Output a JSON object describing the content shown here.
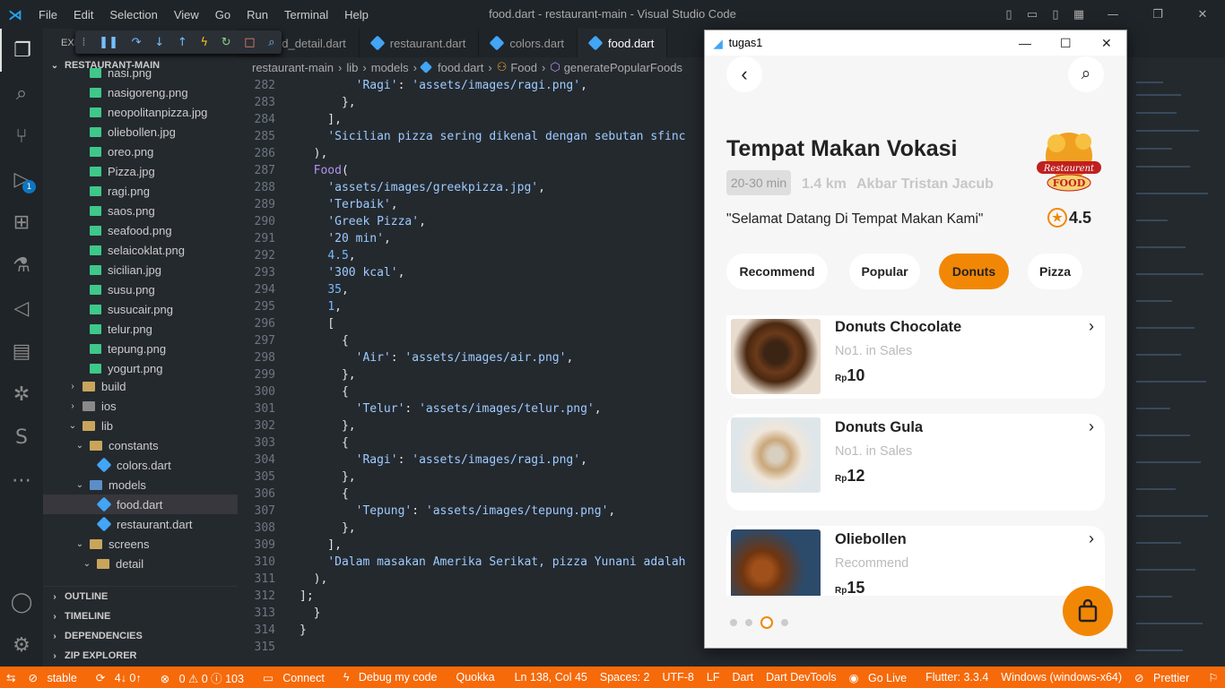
{
  "titlebar": {
    "menu": [
      "File",
      "Edit",
      "Selection",
      "View",
      "Go",
      "Run",
      "Terminal",
      "Help"
    ],
    "title": "food.dart - restaurant-main - Visual Studio Code"
  },
  "sidebar": {
    "header": "EXI",
    "root": "RESTAURANT-MAIN",
    "files": [
      "nasi.png",
      "nasigoreng.png",
      "neopolitanpizza.jpg",
      "oliebollen.jpg",
      "oreo.png",
      "Pizza.jpg",
      "ragi.png",
      "saos.png",
      "seafood.png",
      "selaicoklat.png",
      "sicilian.jpg",
      "susu.png",
      "susucair.png",
      "telur.png",
      "tepung.png",
      "yogurt.png"
    ],
    "folders": {
      "build": "build",
      "ios": "ios",
      "lib": "lib",
      "constants": "constants",
      "colors": "colors.dart",
      "models": "models",
      "food": "food.dart",
      "restaurant": "restaurant.dart",
      "screens": "screens",
      "detail": "detail"
    },
    "sections": [
      "OUTLINE",
      "TIMELINE",
      "DEPENDENCIES",
      "ZIP EXPLORER"
    ]
  },
  "tabs": [
    "od_detail.dart",
    "restaurant.dart",
    "colors.dart",
    "food.dart"
  ],
  "breadcrumb": [
    "restaurant-main",
    "lib",
    "models",
    "food.dart",
    "Food",
    "generatePopularFoods"
  ],
  "code": [
    {
      "n": "282",
      "t": "        'Ragi': 'assets/images/ragi.png',"
    },
    {
      "n": "283",
      "t": "      },"
    },
    {
      "n": "284",
      "t": "    ],"
    },
    {
      "n": "285",
      "t": "    'Sicilian pizza sering dikenal dengan sebutan sfinc"
    },
    {
      "n": "286",
      "t": "  ),"
    },
    {
      "n": "287",
      "t": "  Food("
    },
    {
      "n": "288",
      "t": "    'assets/images/greekpizza.jpg',"
    },
    {
      "n": "289",
      "t": "    'Terbaik',"
    },
    {
      "n": "290",
      "t": "    'Greek Pizza',"
    },
    {
      "n": "291",
      "t": "    '20 min',"
    },
    {
      "n": "292",
      "t": "    4.5,"
    },
    {
      "n": "293",
      "t": "    '300 kcal',"
    },
    {
      "n": "294",
      "t": "    35,"
    },
    {
      "n": "295",
      "t": "    1,"
    },
    {
      "n": "296",
      "t": "    ["
    },
    {
      "n": "297",
      "t": "      {"
    },
    {
      "n": "298",
      "t": "        'Air': 'assets/images/air.png',"
    },
    {
      "n": "299",
      "t": "      },"
    },
    {
      "n": "300",
      "t": "      {"
    },
    {
      "n": "301",
      "t": "        'Telur': 'assets/images/telur.png',"
    },
    {
      "n": "302",
      "t": "      },"
    },
    {
      "n": "303",
      "t": "      {"
    },
    {
      "n": "304",
      "t": "        'Ragi': 'assets/images/ragi.png',"
    },
    {
      "n": "305",
      "t": "      },"
    },
    {
      "n": "306",
      "t": "      {"
    },
    {
      "n": "307",
      "t": "        'Tepung': 'assets/images/tepung.png',"
    },
    {
      "n": "308",
      "t": "      },"
    },
    {
      "n": "309",
      "t": "    ],"
    },
    {
      "n": "310",
      "t": "    'Dalam masakan Amerika Serikat, pizza Yunani adalah"
    },
    {
      "n": "311",
      "t": "  ),"
    },
    {
      "n": "312",
      "t": "];"
    },
    {
      "n": "313",
      "t": "  }"
    },
    {
      "n": "314",
      "t": "}"
    },
    {
      "n": "315",
      "t": ""
    }
  ],
  "status": [
    "stable",
    "4↓ 0↑",
    "0 ⚠ 0 ⓘ 103",
    "Connect",
    "Debug my code",
    "Quokka",
    "Ln 138, Col 45",
    "Spaces: 2",
    "UTF-8",
    "LF",
    "Dart",
    "Dart DevTools",
    "Go Live",
    "Flutter: 3.3.4",
    "Windows (windows-x64)",
    "Prettier"
  ],
  "emulator": {
    "title": "tugas1",
    "restaurant": "Tempat Makan Vokasi",
    "time": "20-30 min",
    "distance": "1.4 km",
    "author": "Akbar Tristan Jacub",
    "welcome": "\"Selamat Datang Di Tempat Makan Kami\"",
    "rating": "4.5",
    "logo_text": "Restaurent FOOD",
    "categories": [
      "Recommend",
      "Popular",
      "Donuts",
      "Pizza"
    ],
    "items": [
      {
        "name": "Donuts Chocolate",
        "highlight": "No1. in Sales",
        "currency": "Rp",
        "price": "10"
      },
      {
        "name": "Donuts Gula",
        "highlight": "No1. in Sales",
        "currency": "Rp",
        "price": "12"
      },
      {
        "name": "Oliebollen",
        "highlight": "Recommend",
        "currency": "Rp",
        "price": "15"
      }
    ],
    "accent": "#f28705"
  }
}
